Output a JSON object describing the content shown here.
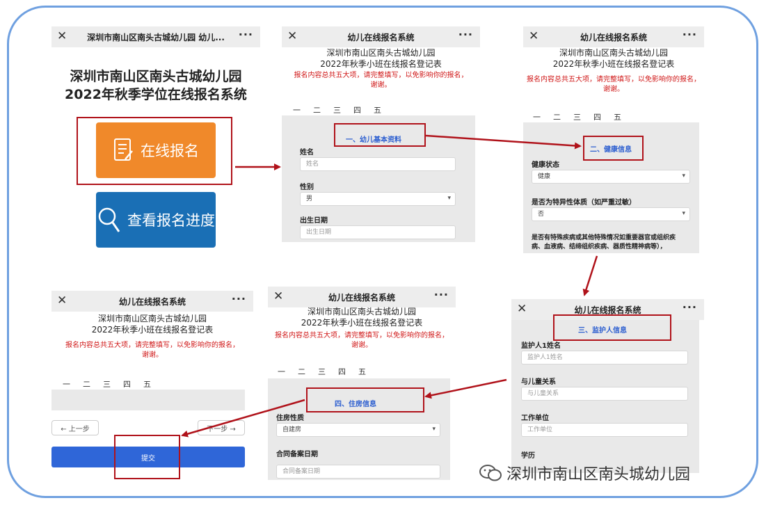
{
  "header": {
    "menu": "···",
    "close": "✕"
  },
  "phone1": {
    "title": "深圳市南山区南头古城幼儿园 幼儿...",
    "heading1": "深圳市南山区南头古城幼儿园",
    "heading2": "2022年秋季学位在线报名系统",
    "btn_register": "在线报名",
    "btn_progress": "查看报名进度"
  },
  "system_title": "幼儿在线报名系统",
  "form_heading1": "深圳市南山区南头古城幼儿园",
  "form_heading2": "2022年秋季小班在线报名登记表",
  "notice_line1": "报名内容总共五大项，请完整填写，以免影响你的报名，",
  "notice_line2": "谢谢。",
  "steps": [
    "一",
    "二",
    "三",
    "四",
    "五"
  ],
  "phone2": {
    "section": "一、幼儿基本资料",
    "name_label": "姓名",
    "name_placeholder": "姓名",
    "gender_label": "性别",
    "gender_value": "男",
    "dob_label": "出生日期",
    "dob_placeholder": "出生日期"
  },
  "phone3": {
    "section": "二、健康信息",
    "health_label": "健康状态",
    "health_value": "健康",
    "allergy_label": "是否为特异性体质（如严重过敏）",
    "allergy_value": "否",
    "disease_label1": "是否有特殊疾病或其他特殊情况如重要器官或组织疾",
    "disease_label2": "病、血液病、结缔组织疾病、器质性精神病等），"
  },
  "phone4": {
    "section": "三、监护人信息",
    "guardian_label": "监护人1姓名",
    "guardian_placeholder": "监护人1姓名",
    "relation_label": "与儿童关系",
    "relation_placeholder": "与儿童关系",
    "work_label": "工作单位",
    "work_placeholder": "工作单位",
    "edu_label": "学历"
  },
  "phone5": {
    "section": "四、住房信息",
    "housing_label": "住房性质",
    "housing_value": "自建房",
    "contract_label": "合同备案日期",
    "contract_placeholder": "合同备案日期"
  },
  "phone6": {
    "prev": "← 上一步",
    "next": "下一步 →",
    "submit": "提交"
  },
  "watermark": "深圳市南山区南头城幼儿园",
  "colors": {
    "frame": "#6fa0e0",
    "highlight": "#b0121a",
    "orange": "#f0892a",
    "blue": "#1a6fb5",
    "section": "#2d5fd0",
    "submit": "#2f66d8"
  }
}
